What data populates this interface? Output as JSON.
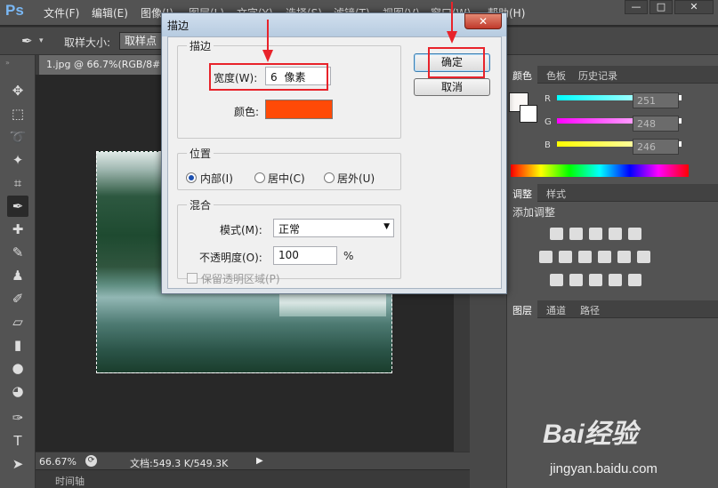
{
  "app": {
    "logo": "Ps"
  },
  "menubar": {
    "items": [
      "文件(F)",
      "编辑(E)",
      "图像(I)",
      "图层(L)",
      "文字(Y)",
      "选择(S)",
      "滤镜(T)",
      "视图(V)",
      "窗口(W)",
      "帮助(H)"
    ],
    "win_minimize": "—",
    "win_restore": "□",
    "win_close": "✕"
  },
  "options": {
    "sample_size_label": "取样大小:",
    "sample_size_value": "取样点"
  },
  "document": {
    "tab_title": "1.jpg @ 66.7%(RGB/8#)",
    "zoom": "66.67%",
    "info": "文档:549.3 K/549.3K"
  },
  "timeline": {
    "label": "时间轴"
  },
  "panels": {
    "color_tabs": [
      "颜色",
      "色板",
      "历史记录"
    ],
    "rgb": [
      {
        "label": "R",
        "value": "251"
      },
      {
        "label": "G",
        "value": "248"
      },
      {
        "label": "B",
        "value": "246"
      }
    ],
    "adjust_tabs": [
      "调整",
      "样式"
    ],
    "adjust_title": "添加调整",
    "layers_tabs": [
      "图层",
      "通道",
      "路径"
    ]
  },
  "dialog": {
    "title": "描边",
    "close": "✕",
    "stroke_group": "描边",
    "width_label": "宽度(W):",
    "width_value": "6",
    "width_unit": "像素",
    "color_label": "颜色:",
    "color_value": "#ff4a07",
    "position_group": "位置",
    "position_inside": "内部(I)",
    "position_center": "居中(C)",
    "position_outside": "居外(U)",
    "blend_group": "混合",
    "mode_label": "模式(M):",
    "mode_value": "正常",
    "opacity_label": "不透明度(O):",
    "opacity_value": "100",
    "opacity_unit": "%",
    "preserve_label": "保留透明区域(P)",
    "ok": "确定",
    "cancel": "取消"
  },
  "watermark": {
    "brand": "Bai经验",
    "url": "jingyan.baidu.com"
  },
  "colors": {
    "annotation_red": "#e8232b",
    "stroke_color": "#ff4a07",
    "ps_blue": "#7ab8f5"
  }
}
